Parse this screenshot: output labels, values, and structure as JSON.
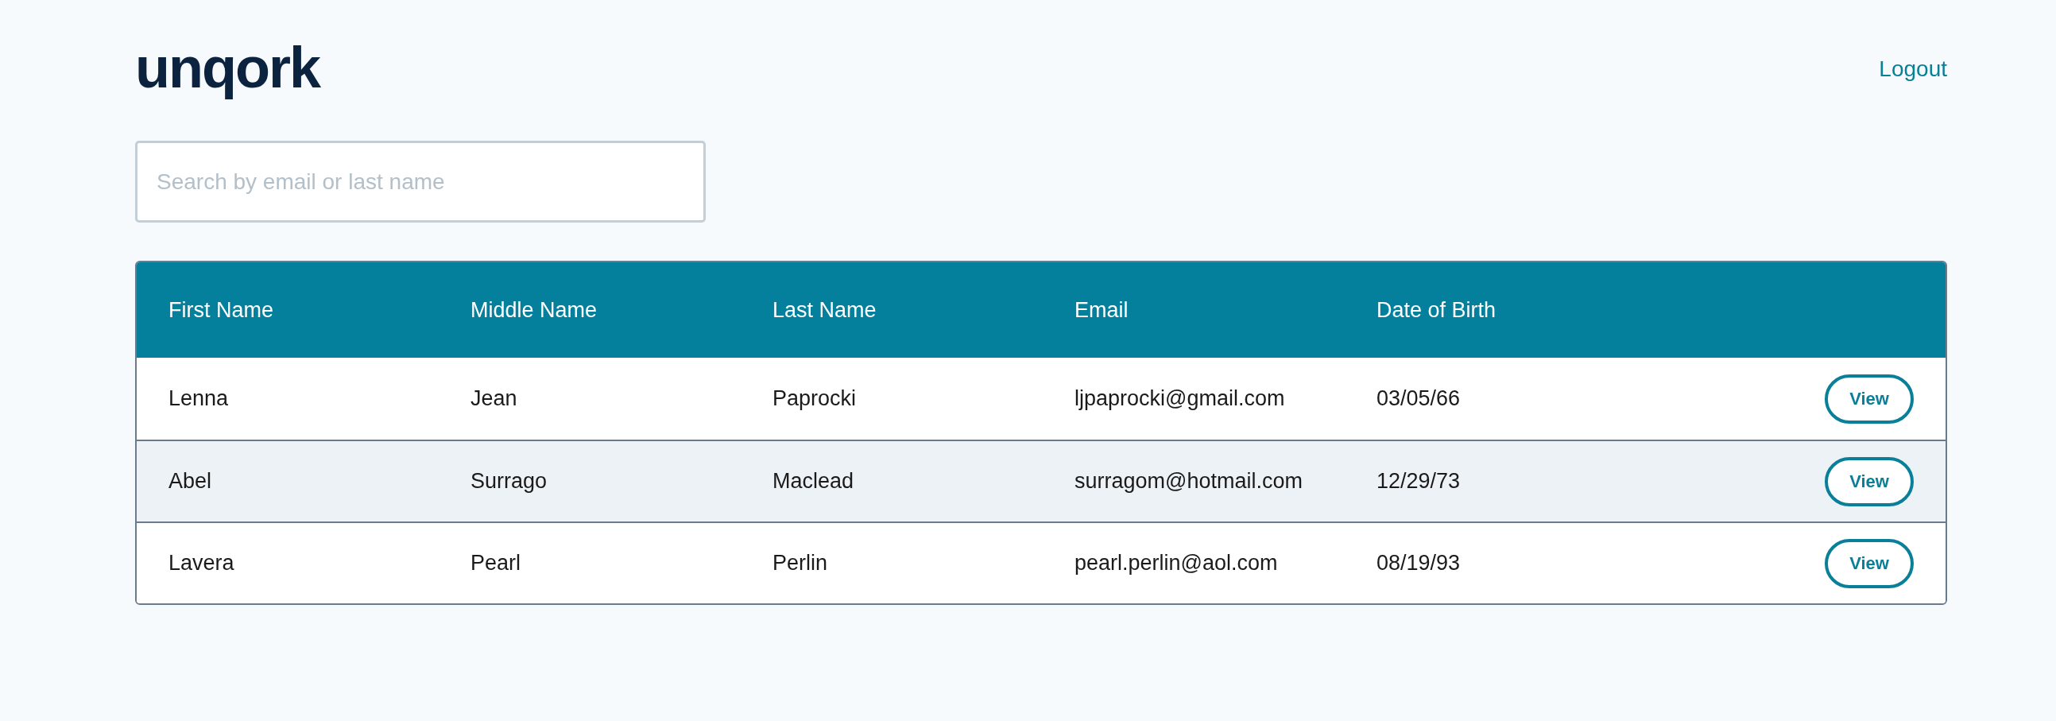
{
  "header": {
    "logo": "unqork",
    "logout": "Logout"
  },
  "search": {
    "placeholder": "Search by email or last name"
  },
  "table": {
    "columns": [
      "First Name",
      "Middle Name",
      "Last Name",
      "Email",
      "Date of Birth"
    ],
    "rows": [
      {
        "cells": [
          "Lenna",
          "Jean",
          "Paprocki",
          "ljpaprocki@gmail.com",
          "03/05/66"
        ],
        "action": "View"
      },
      {
        "cells": [
          "Abel",
          "Surrago",
          "Maclead",
          "surragom@hotmail.com",
          "12/29/73"
        ],
        "action": "View"
      },
      {
        "cells": [
          "Lavera",
          "Pearl",
          "Perlin",
          "pearl.perlin@aol.com",
          "08/19/93"
        ],
        "action": "View"
      }
    ]
  }
}
